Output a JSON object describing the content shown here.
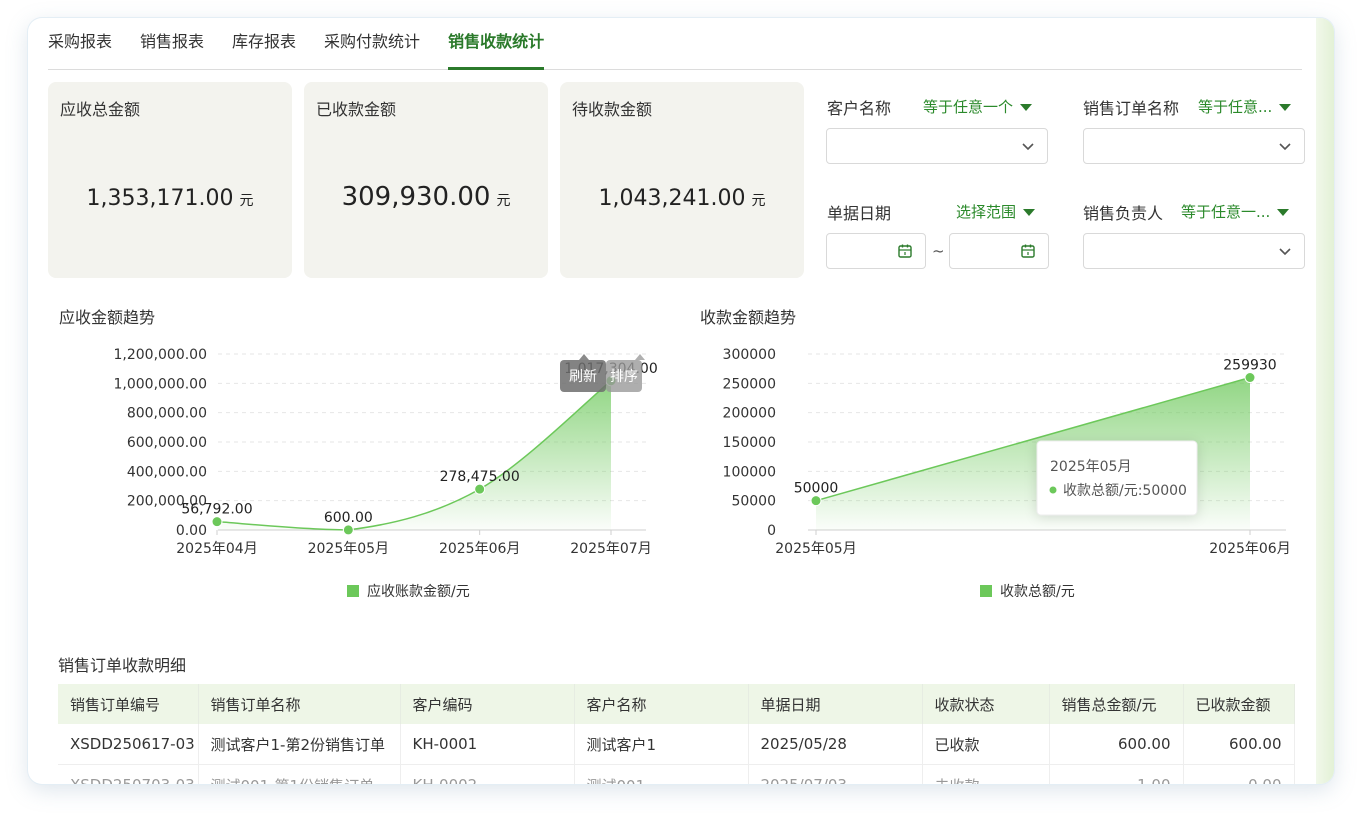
{
  "tabs": [
    {
      "label": "采购报表"
    },
    {
      "label": "销售报表"
    },
    {
      "label": "库存报表"
    },
    {
      "label": "采购付款统计"
    },
    {
      "label": "销售收款统计",
      "active": true
    }
  ],
  "cards": [
    {
      "title": "应收总金额",
      "value": "1,353,171.00",
      "unit": "元"
    },
    {
      "title": "已收款金额",
      "value": "309,930.00",
      "unit": "元"
    },
    {
      "title": "待收款金额",
      "value": "1,043,241.00",
      "unit": "元"
    }
  ],
  "filters": {
    "customer": {
      "label": "客户名称",
      "op": "等于任意一个"
    },
    "order_name": {
      "label": "销售订单名称",
      "op": "等于任意..."
    },
    "date": {
      "label": "单据日期",
      "op": "选择范围",
      "separator": "~"
    },
    "owner": {
      "label": "销售负责人",
      "op": "等于任意一..."
    }
  },
  "colors": {
    "accent": "#2b7a2b",
    "series": "#6cc85a",
    "card_bg": "#f3f3ee",
    "header_bg": "#eef6e7"
  },
  "chart_data": [
    {
      "type": "area",
      "title": "应收金额趋势",
      "categories": [
        "2025年04月",
        "2025年05月",
        "2025年06月",
        "2025年07月"
      ],
      "series": [
        {
          "name": "应收账款金额/元",
          "values": [
            56792,
            600,
            278475,
            1017304
          ]
        }
      ],
      "data_labels": [
        "56,792.00",
        "600.00",
        "278,475.00",
        "1,017,304.00"
      ],
      "yticks": [
        "0.00",
        "200,000.00",
        "400,000.00",
        "600,000.00",
        "800,000.00",
        "1,000,000.00",
        "1,200,000.00"
      ],
      "ylim": [
        0,
        1200000
      ],
      "smooth": true,
      "legend": "bottom",
      "toolbar": [
        "刷新",
        "排序"
      ]
    },
    {
      "type": "area",
      "title": "收款金额趋势",
      "categories": [
        "2025年05月",
        "2025年06月"
      ],
      "series": [
        {
          "name": "收款总额/元",
          "values": [
            50000,
            259930
          ]
        }
      ],
      "data_labels": [
        "50000",
        "259930"
      ],
      "yticks": [
        "0",
        "50000",
        "100000",
        "150000",
        "200000",
        "250000",
        "300000"
      ],
      "ylim": [
        0,
        300000
      ],
      "legend": "bottom",
      "tooltip": {
        "title": "2025年05月",
        "text": "收款总额/元:50000"
      }
    }
  ],
  "table": {
    "title": "销售订单收款明细",
    "columns": [
      "销售订单编号",
      "销售订单名称",
      "客户编码",
      "客户名称",
      "单据日期",
      "收款状态",
      "销售总金额/元",
      "已收款金额"
    ],
    "rows": [
      [
        "XSDD250617-03",
        "测试客户1-第2份销售订单",
        "KH-0001",
        "测试客户1",
        "2025/05/28",
        "已收款",
        "600.00",
        "600.00"
      ],
      [
        "XSDD250703-03",
        "测试001-第1份销售订单",
        "KH-0002",
        "测试001",
        "2025/07/03",
        "未收款",
        "1.00",
        "0.00"
      ]
    ]
  }
}
